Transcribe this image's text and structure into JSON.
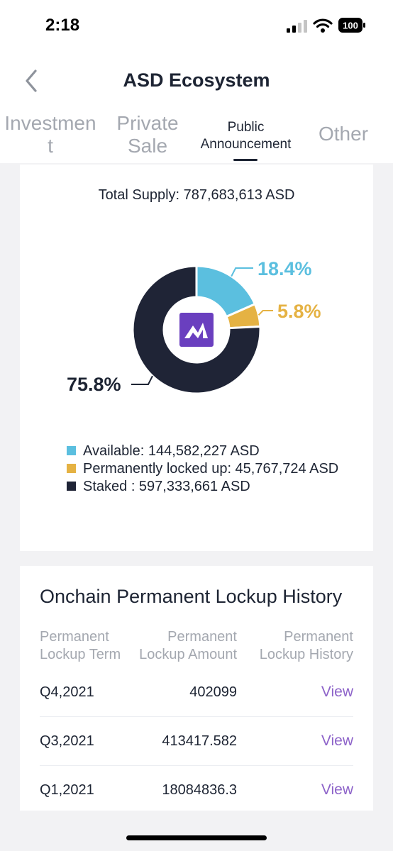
{
  "status_bar": {
    "time": "2:18",
    "battery": "100"
  },
  "header": {
    "title": "ASD Ecosystem"
  },
  "tabs": [
    {
      "label": "Investmen t",
      "line1": "Investmen",
      "line2": "t",
      "active": false
    },
    {
      "label": "Private Sale",
      "line1": "Private",
      "line2": "Sale",
      "active": false
    },
    {
      "label": "Public Announcement",
      "line1": "Public",
      "line2": "Announcement",
      "active": true
    },
    {
      "label": "Other",
      "line1": "Other",
      "line2": "",
      "active": false
    }
  ],
  "supply": {
    "text": "Total Supply: 787,683,613 ASD"
  },
  "chart_data": {
    "type": "pie",
    "style": "donut",
    "title": "",
    "slices": [
      {
        "name": "Available",
        "value": 18.4,
        "label": "18.4%",
        "color": "#5bbfdf"
      },
      {
        "name": "Permanently locked up",
        "value": 5.8,
        "label": "5.8%",
        "color": "#e5b243"
      },
      {
        "name": "Staked",
        "value": 75.8,
        "label": "75.8%",
        "color": "#1f2436"
      }
    ],
    "center_logo_color": "#6a3fbf"
  },
  "legend": [
    {
      "text": "Available: 144,582,227 ASD",
      "color": "#5bbfdf"
    },
    {
      "text": "Permanently locked up: 45,767,724 ASD",
      "color": "#e5b243"
    },
    {
      "text": "Staked : 597,333,661 ASD",
      "color": "#1f2436"
    }
  ],
  "history": {
    "title": "Onchain Permanent Lockup History",
    "columns": [
      {
        "line1": "Permanent",
        "line2": "Lockup Term"
      },
      {
        "line1": "Permanent",
        "line2": "Lockup Amount"
      },
      {
        "line1": "Permanent",
        "line2": "Lockup History"
      }
    ],
    "rows": [
      {
        "term": "Q4,2021",
        "amount": "402099",
        "action": "View"
      },
      {
        "term": "Q3,2021",
        "amount": "413417.582",
        "action": "View"
      },
      {
        "term": "Q1,2021",
        "amount": "18084836.3",
        "action": "View"
      }
    ]
  }
}
